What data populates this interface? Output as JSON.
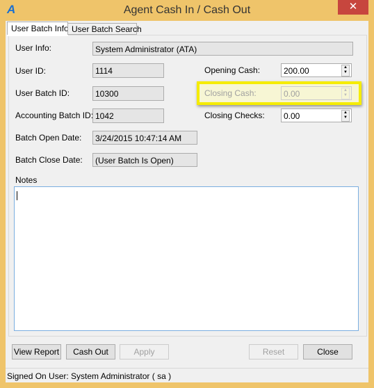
{
  "window": {
    "title": "Agent Cash In / Cash Out",
    "close": "✕",
    "logo": "A"
  },
  "tabs": [
    {
      "label": "User Batch Info",
      "active": true
    },
    {
      "label": "User Batch Search",
      "active": false
    }
  ],
  "fields": {
    "user_info": {
      "label": "User Info:",
      "value": "System Administrator (ATA)"
    },
    "user_id": {
      "label": "User ID:",
      "value": "1114"
    },
    "user_batch_id": {
      "label": "User Batch ID:",
      "value": "10300"
    },
    "accounting_batch_id": {
      "label": "Accounting Batch ID:",
      "value": "1042"
    },
    "batch_open_date": {
      "label": "Batch Open Date:",
      "value": "3/24/2015 10:47:14 AM"
    },
    "batch_close_date": {
      "label": "Batch Close Date:",
      "value": "(User Batch Is Open)"
    },
    "opening_cash": {
      "label": "Opening Cash:",
      "value": "200.00"
    },
    "closing_cash": {
      "label": "Closing Cash:",
      "value": "0.00",
      "disabled": true,
      "highlighted": true,
      "highlight_color": "#f5ec00"
    },
    "closing_checks": {
      "label": "Closing Checks:",
      "value": "0.00"
    },
    "notes": {
      "label": "Notes",
      "value": ""
    }
  },
  "buttons": {
    "view_report": "View Report",
    "cash_out": "Cash Out",
    "apply": "Apply",
    "reset": "Reset",
    "close": "Close"
  },
  "status": "Signed On User: System Administrator ( sa )"
}
